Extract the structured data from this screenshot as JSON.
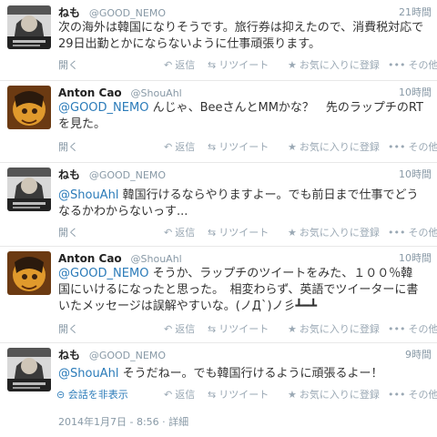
{
  "tweets": [
    {
      "name": "ねも",
      "handle": "@GOOD_NEMO",
      "time": "21時間",
      "text": "次の海外は韓国になりそうです。旅行券は抑えたので、消費税対応で29日出勤とかにならないように仕事頑張ります。",
      "expand": "開く"
    },
    {
      "name": "Anton Cao",
      "handle": "@ShouAhl",
      "time": "10時間",
      "mention": "@GOOD_NEMO",
      "text": " んじゃ、BeeさんとMMかな？　先のラップチのRTを見た。",
      "expand": "開く"
    },
    {
      "name": "ねも",
      "handle": "@GOOD_NEMO",
      "time": "10時間",
      "mention": "@ShouAhl",
      "text": " 韓国行けるならやりますよー。でも前日まで仕事でどうなるかわからないっす...",
      "expand": "開く"
    },
    {
      "name": "Anton Cao",
      "handle": "@ShouAhl",
      "time": "10時間",
      "mention": "@GOOD_NEMO",
      "text": " そうか、ラップチのツイートをみた、１００％韓国にいけるになったと思った。　相変わらず、英語でツイーターに書いたメッセージは誤解やすいな。(ノД`)ノ彡┻━┻",
      "expand": "開く"
    },
    {
      "name": "ねも",
      "handle": "@GOOD_NEMO",
      "time": "9時間",
      "mention": "@ShouAhl",
      "text": " そうだねー。でも韓国行けるように頑張るよー！",
      "expand": "会話を非表示"
    }
  ],
  "actions": {
    "reply": "返信",
    "retweet": "リツイート",
    "favorite": "お気に入りに登録",
    "more": "その他"
  },
  "footer": {
    "timestamp": "2014年1月7日 - 8:56",
    "separator": "·",
    "detail": "詳細"
  },
  "icons": {
    "reply": "reply-arrow-icon",
    "retweet": "retweet-icon",
    "favorite": "star-icon",
    "more": "ellipsis-icon",
    "collapse": "collapse-circle-icon"
  }
}
